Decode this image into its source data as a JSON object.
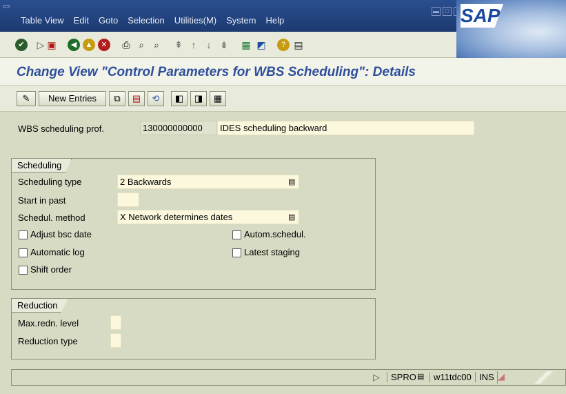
{
  "menu": [
    "Table View",
    "Edit",
    "Goto",
    "Selection",
    "Utilities(M)",
    "System",
    "Help"
  ],
  "logo": "SAP",
  "title": "Change View \"Control Parameters for WBS Scheduling\": Details",
  "appbar": {
    "new_entries": "New Entries"
  },
  "header_field": {
    "label": "WBS scheduling prof.",
    "value": "130000000000",
    "description": "IDES scheduling backward"
  },
  "scheduling": {
    "group_title": "Scheduling",
    "type_label": "Scheduling type",
    "type_value": "2 Backwards",
    "start_past_label": "Start in past",
    "start_past_value": "",
    "method_label": "Schedul. method",
    "method_value": "X Network determines dates",
    "checkboxes": {
      "adjust": "Adjust bsc date",
      "autolog": "Automatic log",
      "shift": "Shift order",
      "autosched": "Autom.schedul.",
      "latest": "Latest staging"
    }
  },
  "reduction": {
    "group_title": "Reduction",
    "max_label": "Max.redn. level",
    "type_label": "Reduction type"
  },
  "status": {
    "tcode": "SPRO",
    "server": "w11tdc00",
    "mode": "INS"
  }
}
